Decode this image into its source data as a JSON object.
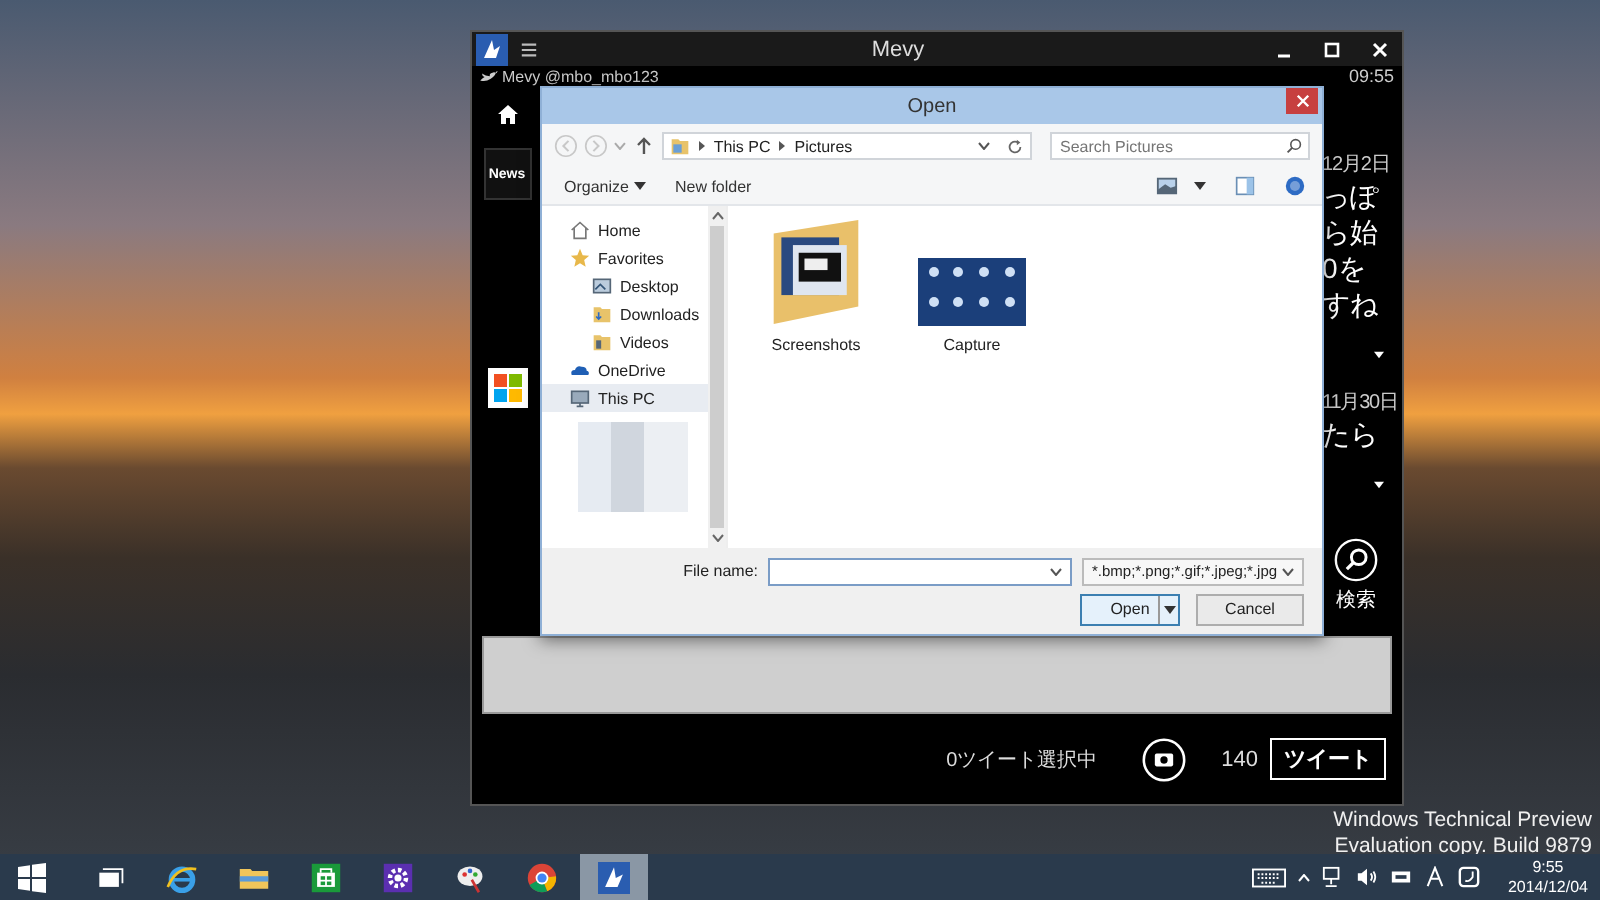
{
  "desktop": {
    "watermark": [
      "Windows Technical Preview",
      "Evaluation copy. Build 9879"
    ]
  },
  "mevy": {
    "title": "Mevy",
    "account": "Mevy @mbo_mbo123",
    "time": "09:55",
    "news_logo": "News",
    "tweets": [
      {
        "date": "12月2日",
        "lines": [
          "っぽ",
          "ら始",
          "0を",
          "すね"
        ]
      },
      {
        "date": "11月30日",
        "lines": [
          "たら"
        ]
      }
    ],
    "search_label": "検索",
    "selected_count": "0ツイート選択中",
    "remaining": "140",
    "tweet_button": "ツイート"
  },
  "dialog": {
    "title": "Open",
    "path": [
      "This PC",
      "Pictures"
    ],
    "search": {
      "placeholder": "Search Pictures"
    },
    "toolbar": [
      "Organize",
      "New folder"
    ],
    "nav": [
      {
        "label": "Home",
        "kind": "home",
        "selected": false
      },
      {
        "label": "Favorites",
        "kind": "star",
        "selected": false,
        "children": [
          {
            "label": "Desktop",
            "kind": "desktop",
            "selected": false
          },
          {
            "label": "Downloads",
            "kind": "download",
            "selected": false
          },
          {
            "label": "Videos",
            "kind": "video",
            "selected": false
          }
        ]
      },
      {
        "label": "OneDrive",
        "kind": "cloud",
        "selected": false
      },
      {
        "label": "This PC",
        "kind": "pc",
        "selected": true
      }
    ],
    "items": [
      {
        "name": "Screenshots",
        "kind": "folder"
      },
      {
        "name": "Capture",
        "kind": "image"
      }
    ],
    "filename": {
      "label": "File name:"
    },
    "filter": "*.bmp;*.png;*.gif;*.jpeg;*.jpg",
    "buttons": [
      "Open",
      "Cancel"
    ]
  },
  "taskbar": {
    "apps": [
      {
        "kind": "taskview",
        "selected": false
      },
      {
        "kind": "browser",
        "selected": false
      },
      {
        "kind": "explorer",
        "selected": false
      },
      {
        "kind": "store",
        "selected": false
      },
      {
        "kind": "settings",
        "selected": false
      },
      {
        "kind": "paint",
        "selected": false
      },
      {
        "kind": "chrome",
        "selected": false
      },
      {
        "kind": "mevy",
        "selected": true
      }
    ],
    "clock": {
      "time": "9:55",
      "date": "2014/12/04"
    }
  }
}
